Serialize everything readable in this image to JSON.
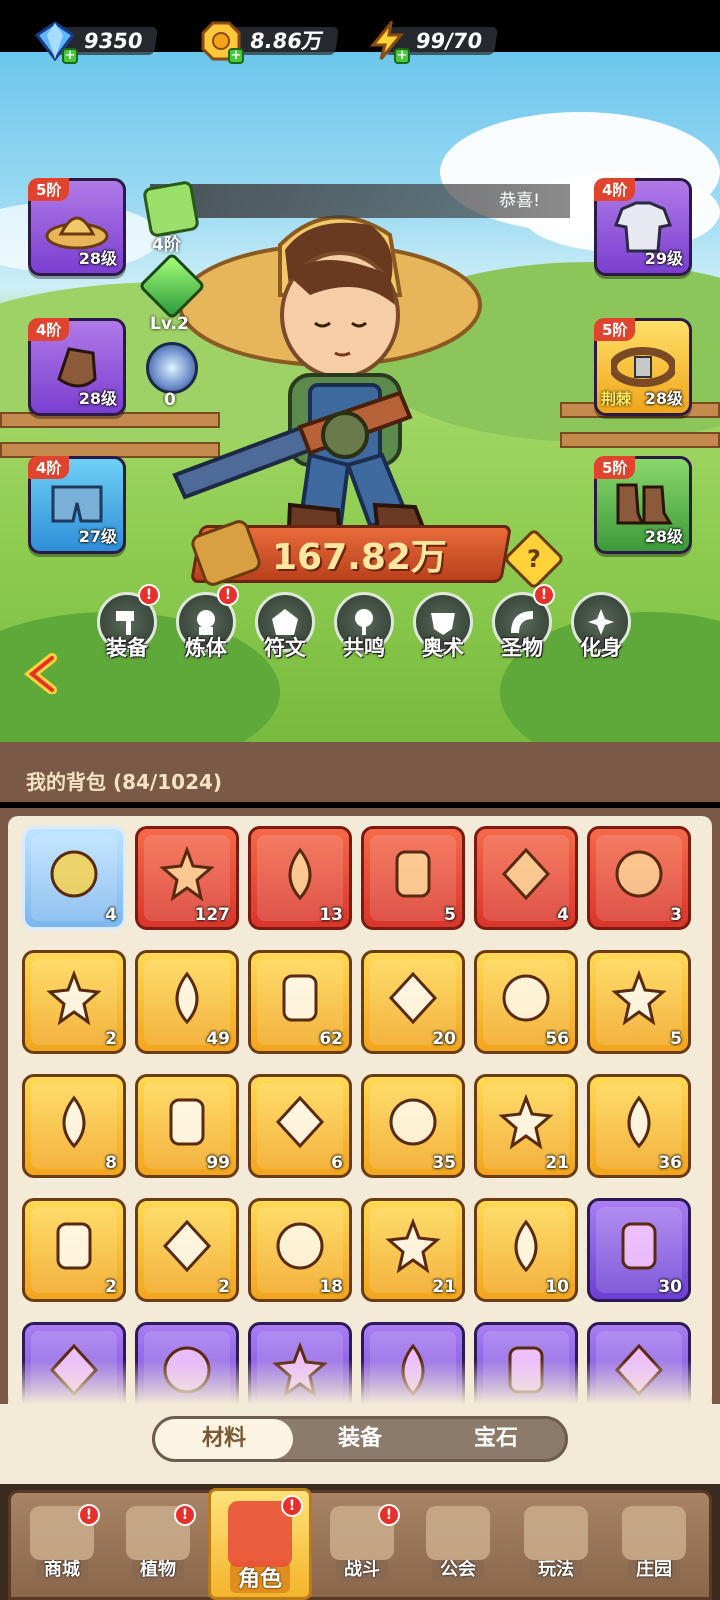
{
  "currencies": [
    {
      "icon": "diamond-icon",
      "value": "9350"
    },
    {
      "icon": "gold-coin-icon",
      "value": "8.86万"
    },
    {
      "icon": "energy-bolt-icon",
      "value": "99/70"
    }
  ],
  "banner_text": "恭喜!",
  "left_stats": {
    "top_tier": "4阶",
    "level": "Lv.2",
    "orb_count": "0"
  },
  "equipment_left": [
    {
      "tier": "5阶",
      "level": "28级",
      "icon": "straw-hat-icon",
      "rarity": "purple"
    },
    {
      "tier": "4阶",
      "level": "28级",
      "icon": "gloves-icon",
      "rarity": "purple"
    },
    {
      "tier": "4阶",
      "level": "27级",
      "icon": "shorts-icon",
      "rarity": "blue"
    }
  ],
  "equipment_right": [
    {
      "tier": "4阶",
      "level": "29级",
      "icon": "shirt-icon",
      "rarity": "purple",
      "tag": ""
    },
    {
      "tier": "5阶",
      "level": "28级",
      "icon": "belt-icon",
      "rarity": "gold",
      "tag": "荆棘"
    },
    {
      "tier": "5阶",
      "level": "28级",
      "icon": "boots-icon",
      "rarity": "green",
      "tag": ""
    }
  ],
  "power": "167.82万",
  "help_symbol": "?",
  "functions": [
    {
      "label": "装备",
      "alert": true
    },
    {
      "label": "炼体",
      "alert": true
    },
    {
      "label": "符文",
      "alert": false
    },
    {
      "label": "共鸣",
      "alert": false
    },
    {
      "label": "奥术",
      "alert": false
    },
    {
      "label": "圣物",
      "alert": true
    },
    {
      "label": "化身",
      "alert": false
    }
  ],
  "bag": {
    "title": "我的背包 (84/1024)"
  },
  "items": [
    {
      "icon": "duck-flower-icon",
      "count": "4",
      "rarity": "blu"
    },
    {
      "icon": "star-crystal-icon",
      "count": "127",
      "rarity": "red"
    },
    {
      "icon": "red-potion-icon",
      "count": "13",
      "rarity": "red"
    },
    {
      "icon": "green-canister-icon",
      "count": "5",
      "rarity": "red"
    },
    {
      "icon": "orange-elixir-icon",
      "count": "4",
      "rarity": "red"
    },
    {
      "icon": "rainbow-elixir-icon",
      "count": "3",
      "rarity": "red"
    },
    {
      "icon": "skull-ticket-icon",
      "count": "2",
      "rarity": "yel"
    },
    {
      "icon": "duck-coin-icon",
      "count": "49",
      "rarity": "yel"
    },
    {
      "icon": "basket-icon",
      "count": "62",
      "rarity": "yel"
    },
    {
      "icon": "red-key-icon",
      "count": "20",
      "rarity": "yel"
    },
    {
      "icon": "gold-key-icon",
      "count": "56",
      "rarity": "yel"
    },
    {
      "icon": "golden-flower-icon",
      "count": "5",
      "rarity": "yel"
    },
    {
      "icon": "rune-stone-icon",
      "count": "8",
      "rarity": "yel"
    },
    {
      "icon": "orange-potion-icon",
      "count": "99",
      "rarity": "yel"
    },
    {
      "icon": "gold-ore-icon",
      "count": "6",
      "rarity": "yel"
    },
    {
      "icon": "red-flower-icon",
      "count": "35",
      "rarity": "yel"
    },
    {
      "icon": "pesticide-sprayer-icon",
      "count": "21",
      "rarity": "yel"
    },
    {
      "icon": "spell-book-icon",
      "count": "36",
      "rarity": "yel"
    },
    {
      "icon": "jar-icon",
      "count": "2",
      "rarity": "yel"
    },
    {
      "icon": "amber-crystal-icon",
      "count": "2",
      "rarity": "yel"
    },
    {
      "icon": "teal-potion-icon",
      "count": "18",
      "rarity": "yel"
    },
    {
      "icon": "crimson-potion-icon",
      "count": "21",
      "rarity": "yel"
    },
    {
      "icon": "glowing-flower-icon",
      "count": "10",
      "rarity": "yel"
    },
    {
      "icon": "purple-potion-icon",
      "count": "30",
      "rarity": "pur"
    },
    {
      "icon": "seed-icon",
      "count": "",
      "rarity": "pur"
    },
    {
      "icon": "ice-block-icon",
      "count": "",
      "rarity": "pur"
    },
    {
      "icon": "shield-badge-icon",
      "count": "",
      "rarity": "pur"
    },
    {
      "icon": "leaf-icon",
      "count": "",
      "rarity": "pur"
    },
    {
      "icon": "scroll-icon",
      "count": "",
      "rarity": "pur"
    },
    {
      "icon": "purple-bag-icon",
      "count": "",
      "rarity": "pur"
    }
  ],
  "tabs": [
    {
      "label": "材料",
      "active": true
    },
    {
      "label": "装备",
      "active": false
    },
    {
      "label": "宝石",
      "active": false
    }
  ],
  "nav": [
    {
      "label": "商城",
      "icon": "shop-icon",
      "alert": true
    },
    {
      "label": "植物",
      "icon": "plant-icon",
      "alert": true
    },
    {
      "label": "角色",
      "icon": "character-icon",
      "alert": true,
      "active": true
    },
    {
      "label": "战斗",
      "icon": "battle-icon",
      "alert": true
    },
    {
      "label": "公会",
      "icon": "guild-icon",
      "alert": false
    },
    {
      "label": "玩法",
      "icon": "gameplay-icon",
      "alert": false
    },
    {
      "label": "庄园",
      "icon": "manor-icon",
      "alert": false
    }
  ],
  "colors": {
    "accent": "#f3b42c",
    "alert": "#e8302a",
    "panel": "#7a5a46",
    "bag_bg": "#f4ead8"
  }
}
